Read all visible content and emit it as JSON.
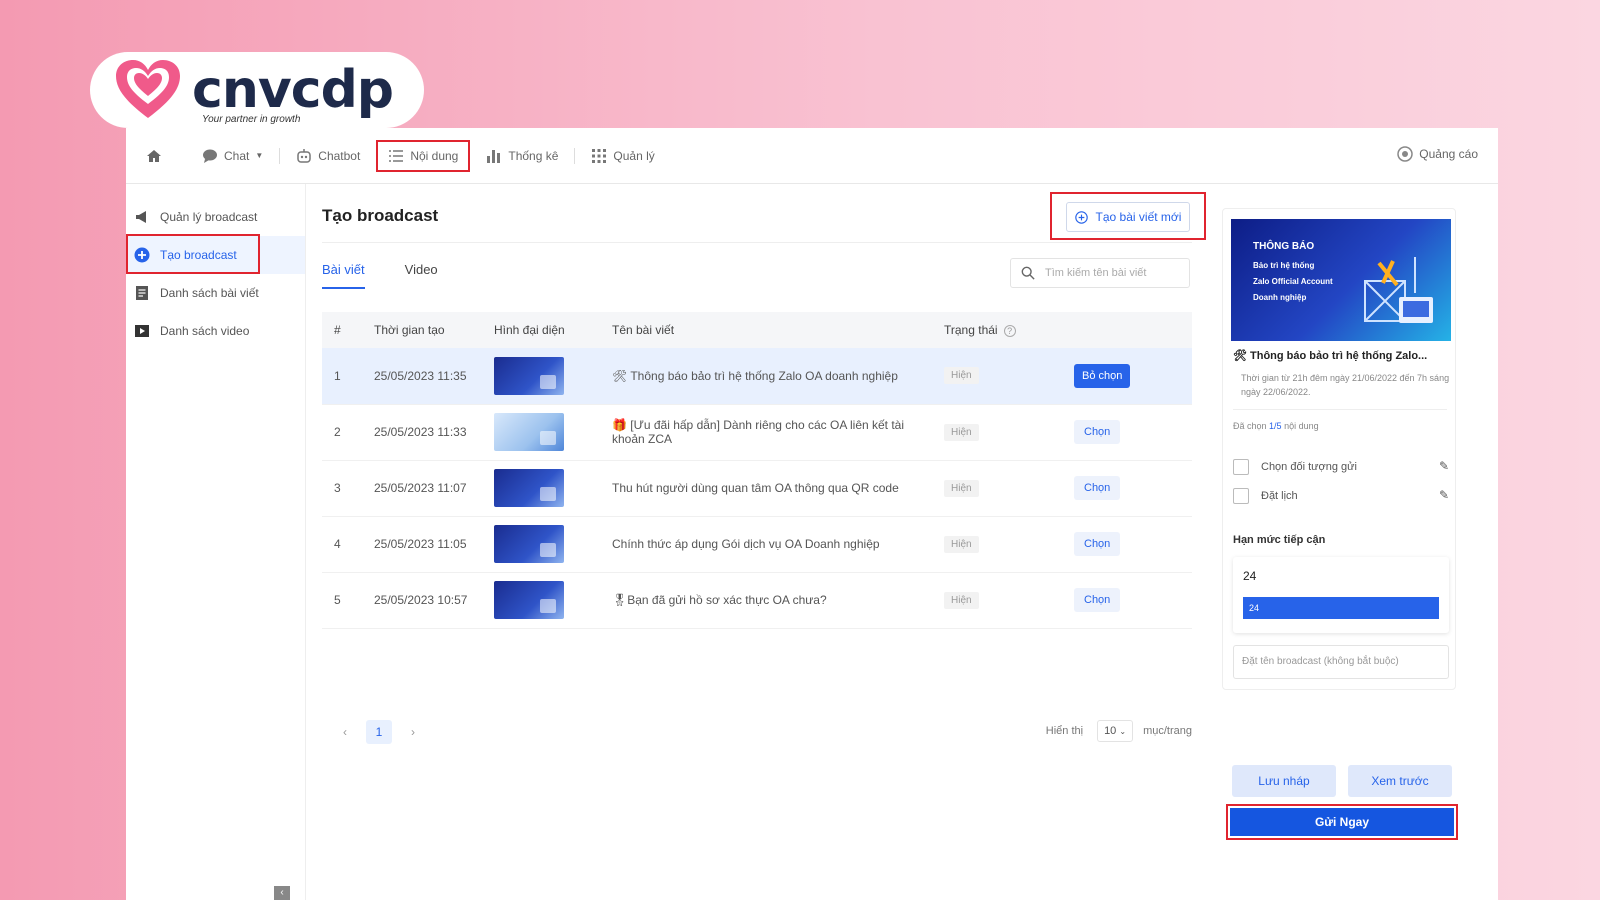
{
  "logo": {
    "word": "cnvcdp",
    "tagline": "Your partner in growth"
  },
  "topnav": {
    "items": [
      {
        "label": "Chat",
        "icon": "chat-icon"
      },
      {
        "label": "Chatbot",
        "icon": "bot-icon"
      },
      {
        "label": "Nội dung",
        "icon": "list-icon"
      },
      {
        "label": "Thống kê",
        "icon": "bar-chart-icon"
      },
      {
        "label": "Quản lý",
        "icon": "grid-icon"
      }
    ],
    "right_label": "Quảng cáo"
  },
  "sidebar": {
    "items": [
      {
        "label": "Quản lý broadcast",
        "icon": "megaphone-icon"
      },
      {
        "label": "Tạo broadcast",
        "icon": "plus-circle-icon"
      },
      {
        "label": "Danh sách bài viết",
        "icon": "document-icon"
      },
      {
        "label": "Danh sách video",
        "icon": "video-icon"
      }
    ],
    "collapse_glyph": "‹"
  },
  "main": {
    "title": "Tạo broadcast",
    "new_post_label": "Tạo bài viết mới",
    "tabs": [
      "Bài viết",
      "Video"
    ],
    "search_placeholder": "Tìm kiếm tên bài viết",
    "columns": [
      "#",
      "Thời gian tạo",
      "Hình đại diện",
      "Tên bài viết",
      "Trạng thái"
    ],
    "rows": [
      {
        "index": "1",
        "created": "25/05/2023 11:35",
        "title": "🛠 Thông báo bảo trì hệ thống Zalo OA doanh nghiệp",
        "status": "Hiện",
        "action": "Bỏ chọn",
        "selected": true
      },
      {
        "index": "2",
        "created": "25/05/2023 11:33",
        "title": "🎁 [Ưu đãi hấp dẫn] Dành riêng cho các OA liên kết tài khoản ZCA",
        "status": "Hiện",
        "action": "Chọn",
        "selected": false
      },
      {
        "index": "3",
        "created": "25/05/2023 11:07",
        "title": "Thu hút người dùng quan tâm OA thông qua QR code",
        "status": "Hiện",
        "action": "Chọn",
        "selected": false
      },
      {
        "index": "4",
        "created": "25/05/2023 11:05",
        "title": "Chính thức áp dụng Gói dịch vụ OA Doanh nghiệp",
        "status": "Hiện",
        "action": "Chọn",
        "selected": false
      },
      {
        "index": "5",
        "created": "25/05/2023 10:57",
        "title": "🎖Bạn đã gửi hồ sơ xác thực OA chưa?",
        "status": "Hiện",
        "action": "Chọn",
        "selected": false
      }
    ],
    "pagination": {
      "prev": "‹",
      "current": "1",
      "next": "›"
    },
    "per_page": {
      "label_before": "Hiển thị",
      "value": "10",
      "label_after": "mục/trang"
    }
  },
  "preview": {
    "banner_heading": "THÔNG BÁO",
    "banner_lines": [
      "Bảo trì hệ thống",
      "Zalo Official Account",
      "Doanh nghiệp"
    ],
    "post_title": "🛠 Thông báo bảo trì hệ thống Zalo...",
    "post_desc": "Thời gian từ 21h đêm ngày 21/06/2022 đến 7h sáng ngày 22/06/2022.",
    "picked_prefix": "Đã chọn",
    "picked_count": "1/5",
    "picked_suffix": "nội dung",
    "options": [
      "Chọn đối tượng gửi",
      "Đặt lịch"
    ],
    "reach_label": "Hạn mức tiếp cận",
    "reach_value": "24",
    "reach_fill_fraction": 1.0,
    "name_placeholder": "Đặt tên broadcast (không bắt buộc)"
  },
  "actions": {
    "draft": "Lưu nháp",
    "preview": "Xem trước",
    "send": "Gửi Ngay"
  },
  "colors": {
    "accent": "#2763e9",
    "highlight": "#e0242f"
  }
}
